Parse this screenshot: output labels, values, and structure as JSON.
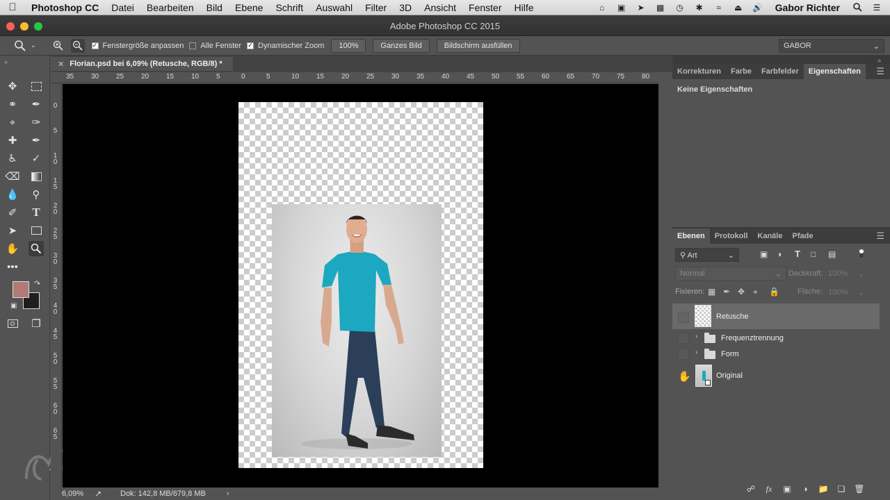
{
  "menubar": {
    "app_name": "Photoshop CC",
    "items": [
      "Datei",
      "Bearbeiten",
      "Bild",
      "Ebene",
      "Schrift",
      "Auswahl",
      "Filter",
      "3D",
      "Ansicht",
      "Fenster",
      "Hilfe"
    ],
    "user": "Gabor Richter"
  },
  "window": {
    "title": "Adobe Photoshop CC 2015"
  },
  "options": {
    "resize_windows_label": "Fenstergröße anpassen",
    "resize_windows_checked": true,
    "all_windows_label": "Alle Fenster",
    "all_windows_checked": false,
    "scrubby_zoom_label": "Dynamischer Zoom",
    "scrubby_zoom_checked": true,
    "zoom_100": "100%",
    "fit_screen": "Ganzes Bild",
    "fill_screen": "Bildschirm ausfüllen",
    "workspace": "GABOR"
  },
  "document": {
    "tab_title": "Florian.psd bei 6,09% (Retusche, RGB/8) *"
  },
  "rulers": {
    "top": [
      "35",
      "30",
      "25",
      "20",
      "15",
      "10",
      "5",
      "0",
      "5",
      "10",
      "15",
      "20",
      "25",
      "30",
      "35",
      "40",
      "45",
      "50",
      "55",
      "60",
      "65",
      "70",
      "75",
      "80"
    ],
    "left": [
      "0",
      "5",
      "1\n0",
      "1\n5",
      "2\n0",
      "2\n5",
      "3\n0",
      "3\n5",
      "4\n0",
      "4\n5",
      "5\n0",
      "5\n5",
      "6\n0",
      "6\n5"
    ]
  },
  "properties_panel": {
    "tabs": [
      "Korrekturen",
      "Farbe",
      "Farbfelder",
      "Eigenschaften"
    ],
    "active_tab": "Eigenschaften",
    "message": "Keine Eigenschaften"
  },
  "layers_panel": {
    "tabs": [
      "Ebenen",
      "Protokoll",
      "Kanäle",
      "Pfade"
    ],
    "active_tab": "Ebenen",
    "filter_kind": "Art",
    "blend_mode": "Normal",
    "opacity_label": "Deckkraft:",
    "opacity_value": "100%",
    "lock_label": "Fixieren:",
    "fill_label": "Fläche:",
    "fill_value": "100%",
    "layers": [
      {
        "name": "Retusche",
        "type": "layer",
        "visible": false,
        "selected": true
      },
      {
        "name": "Frequenztrennung",
        "type": "group",
        "visible": false,
        "selected": false
      },
      {
        "name": "Form",
        "type": "group",
        "visible": false,
        "selected": false
      },
      {
        "name": "Original",
        "type": "smart-object",
        "visible": true,
        "selected": false
      }
    ]
  },
  "status": {
    "zoom": "6,09%",
    "doc_size": "Dok: 142,8 MB/679,8 MB"
  },
  "colors": {
    "foreground": "#b07b75",
    "background": "#1e1e1e",
    "shirt": "#1ba8c0",
    "jeans": "#2b3f5a"
  }
}
